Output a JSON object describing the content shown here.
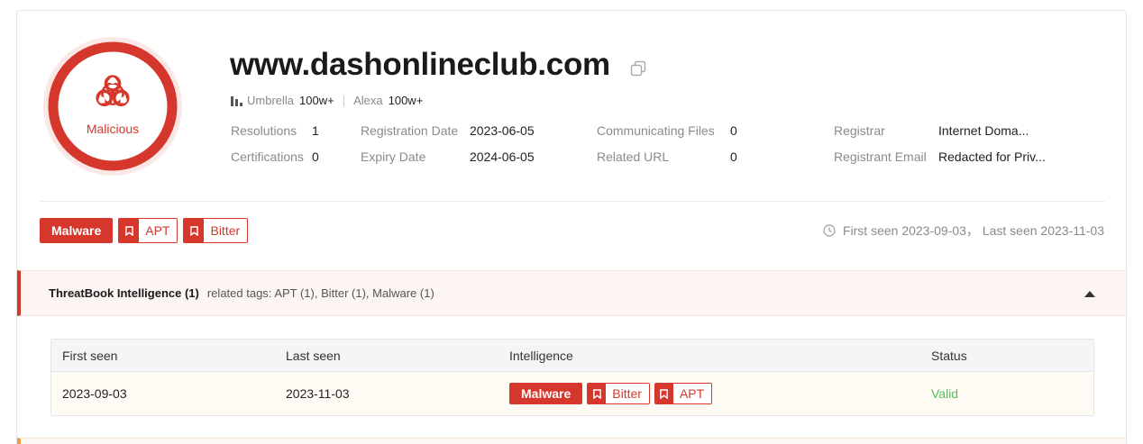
{
  "verdict": {
    "label": "Malicious",
    "color": "#d6372c",
    "icon": "biohazard-icon"
  },
  "domain": {
    "name": "www.dashonlineclub.com"
  },
  "ranks": [
    {
      "name": "Umbrella",
      "value": "100w+"
    },
    {
      "name": "Alexa",
      "value": "100w+"
    }
  ],
  "meta": {
    "resolutions": {
      "label": "Resolutions",
      "value": "1"
    },
    "certifications": {
      "label": "Certifications",
      "value": "0"
    },
    "registration_date": {
      "label": "Registration Date",
      "value": "2023-06-05"
    },
    "expiry_date": {
      "label": "Expiry Date",
      "value": "2024-06-05"
    },
    "communicating_files": {
      "label": "Communicating Files",
      "value": "0"
    },
    "related_url": {
      "label": "Related URL",
      "value": "0"
    },
    "registrar": {
      "label": "Registrar",
      "value": "Internet Doma..."
    },
    "registrant_email": {
      "label": "Registrant Email",
      "value": "Redacted for Priv..."
    }
  },
  "tags": [
    {
      "type": "solid",
      "label": "Malware"
    },
    {
      "type": "outline",
      "label": "APT"
    },
    {
      "type": "outline",
      "label": "Bitter"
    }
  ],
  "seen": "First seen 2023-09-03， Last seen 2023-11-03",
  "intel": {
    "title": "ThreatBook Intelligence (1)",
    "related": "related tags: APT (1), Bitter (1), Malware (1)",
    "columns": [
      "First seen",
      "Last seen",
      "Intelligence",
      "Status"
    ],
    "rows": [
      {
        "first_seen": "2023-09-03",
        "last_seen": "2023-11-03",
        "tags": [
          {
            "type": "solid",
            "label": "Malware"
          },
          {
            "type": "outline",
            "label": "Bitter"
          },
          {
            "type": "outline",
            "label": "APT"
          }
        ],
        "status": "Valid",
        "status_color": "#5cb85c"
      }
    ]
  }
}
